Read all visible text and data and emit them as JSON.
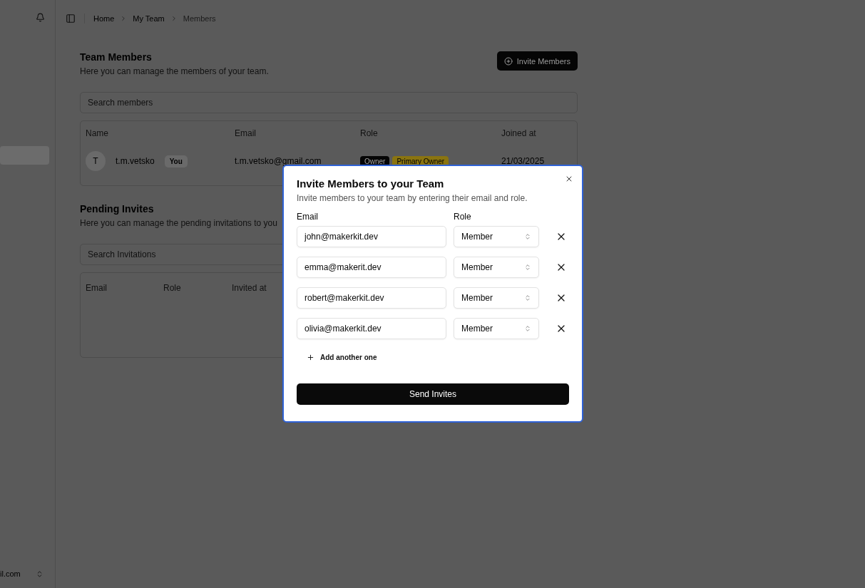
{
  "sidebar": {
    "footer_text": "il.com"
  },
  "breadcrumb": [
    {
      "label": "Home",
      "current": false
    },
    {
      "label": "My Team",
      "current": false
    },
    {
      "label": "Members",
      "current": true
    }
  ],
  "members": {
    "title": "Team Members",
    "description": "Here you can manage the members of your team.",
    "invite_button": "Invite Members",
    "search_placeholder": "Search members",
    "columns": [
      "Name",
      "Email",
      "Role",
      "Joined at"
    ],
    "rows": [
      {
        "avatar": "T",
        "name": "t.m.vetsko",
        "badge": "You",
        "email": "t.m.vetsko@gmail.com",
        "roles": [
          {
            "label": "Owner",
            "kind": "owner"
          },
          {
            "label": "Primary Owner",
            "kind": "primary"
          }
        ],
        "joined": "21/03/2025"
      }
    ]
  },
  "pending": {
    "title": "Pending Invites",
    "description": "Here you can manage the pending invitations to you",
    "search_placeholder": "Search Invitations",
    "columns": [
      "Email",
      "Role",
      "Invited at"
    ]
  },
  "dialog": {
    "title": "Invite Members to your Team",
    "description": "Invite members to your team by entering their email and role.",
    "email_label": "Email",
    "role_label": "Role",
    "rows": [
      {
        "email": "john@makerkit.dev",
        "role": "Member"
      },
      {
        "email": "emma@makerit.dev",
        "role": "Member"
      },
      {
        "email": "robert@makerkit.dev",
        "role": "Member"
      },
      {
        "email": "olivia@makerkit.dev",
        "role": "Member"
      }
    ],
    "add_button": "Add another one",
    "submit_button": "Send Invites"
  }
}
